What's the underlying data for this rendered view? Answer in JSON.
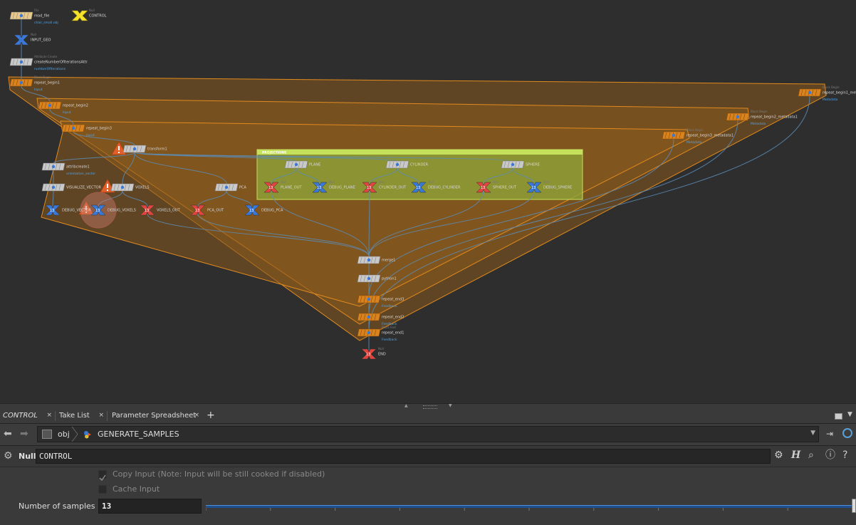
{
  "network": {
    "nodes": [
      {
        "id": "read_file",
        "type": "File",
        "name": "read_file",
        "sub": "chair_small.obj"
      },
      {
        "id": "control",
        "type": "Null",
        "name": "CONTROL"
      },
      {
        "id": "input_geo",
        "type": "Null",
        "name": "INPUT_GEO"
      },
      {
        "id": "create_attr",
        "type": "Attribute Create",
        "name": "createNumberOfIterationsAttr",
        "sub": "numberOfIterations"
      },
      {
        "id": "repeat_begin1",
        "type": "Block Begin",
        "name": "repeat_begin1",
        "sub": "Input"
      },
      {
        "id": "repeat_begin2",
        "name": "repeat_begin2",
        "sub": "Input"
      },
      {
        "id": "repeat_begin3",
        "name": "repeat_begin3",
        "sub": "Input"
      },
      {
        "id": "transform1",
        "name": "transform1"
      },
      {
        "id": "attribcreate1",
        "name": "attribcreate1",
        "sub": "orientation_vector"
      },
      {
        "id": "visualize_vector",
        "name": "VISUALIZE_VECTOR"
      },
      {
        "id": "voxels",
        "name": "VOXELS"
      },
      {
        "id": "pca",
        "name": "PCA"
      },
      {
        "id": "debug_vector",
        "name": "DEBUG_VECTOR"
      },
      {
        "id": "debug_voxels",
        "name": "DEBUG_VOXELS"
      },
      {
        "id": "voxels_out",
        "name": "VOXELS_OUT"
      },
      {
        "id": "pca_out",
        "name": "PCA_OUT"
      },
      {
        "id": "debug_pca",
        "name": "DEBUG_PCA"
      },
      {
        "id": "plane",
        "name": "PLANE"
      },
      {
        "id": "cylinder",
        "name": "CYLINDER"
      },
      {
        "id": "sphere",
        "name": "SPHERE"
      },
      {
        "id": "plane_out",
        "type": "Null",
        "name": "PLANE_OUT"
      },
      {
        "id": "debug_plane",
        "type": "Null",
        "name": "DEBUG_PLANE"
      },
      {
        "id": "cylinder_out",
        "type": "Null",
        "name": "CYLINDER_OUT"
      },
      {
        "id": "debug_cylinder",
        "type": "Null",
        "name": "DEBUG_CYLINDER"
      },
      {
        "id": "sphere_out",
        "type": "Null",
        "name": "SPHERE_OUT"
      },
      {
        "id": "debug_sphere",
        "type": "Null",
        "name": "DEBUG_SPHERE"
      },
      {
        "id": "merge1",
        "name": "merge1"
      },
      {
        "id": "python1",
        "name": "python1"
      },
      {
        "id": "repeat_end3",
        "name": "repeat_end3",
        "sub": "Feedback"
      },
      {
        "id": "repeat_end2",
        "name": "repeat_end2",
        "sub": "Feedback"
      },
      {
        "id": "repeat_end1",
        "type": "Block End",
        "name": "repeat_end1",
        "sub": "Feedback"
      },
      {
        "id": "end",
        "type": "Null",
        "name": "END"
      },
      {
        "id": "metadata1",
        "type": "Block Begin",
        "name": "repeat_begin1_metadata1",
        "sub": "Metadata"
      },
      {
        "id": "metadata2",
        "type": "Block Begin",
        "name": "repeat_begin2_metadata1",
        "sub": "Metadata"
      },
      {
        "id": "metadata3",
        "type": "Block Begin",
        "name": "repeat_begin3_metadata1",
        "sub": "Metadata"
      }
    ],
    "null_badge": "13",
    "projections_label": "PROJECTIONS"
  },
  "tabs": [
    {
      "label": "CONTROL",
      "close": "×"
    },
    {
      "label": "Take List",
      "close": "×"
    },
    {
      "label": "Parameter Spreadsheet",
      "close": "×"
    }
  ],
  "add_tab": "+",
  "path": {
    "root": "obj",
    "current": "GENERATE_SAMPLES"
  },
  "node_bar": {
    "type": "Null",
    "name": "CONTROL",
    "h_label": "H"
  },
  "params": {
    "copy_input_label": "Copy Input (Note: Input will be still cooked if disabled)",
    "copy_input_checked": true,
    "cache_input_label": "Cache Input",
    "cache_input_checked": false,
    "samples_label": "Number of samples",
    "samples_value": "13"
  },
  "colors": {
    "loop_fill": "#8a5a1e",
    "loop_stroke": "#e08a1e",
    "projections_fill": "#8fa83a",
    "projections_stroke": "#c5e05a",
    "null_red": "#e0453f",
    "null_blue": "#3a78d8",
    "wire": "#5b8db8"
  }
}
